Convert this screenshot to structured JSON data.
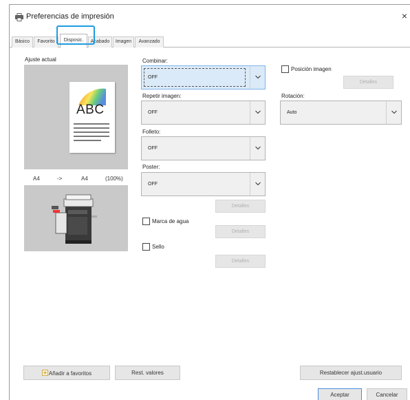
{
  "window": {
    "title": "Preferencias de impresión",
    "close_glyph": "×"
  },
  "tabs": [
    {
      "label": "Básico"
    },
    {
      "label": "Favorito"
    },
    {
      "label": "Disposic."
    },
    {
      "label": "Acabado"
    },
    {
      "label": "Imagen"
    },
    {
      "label": "Avanzado"
    }
  ],
  "active_tab": "Disposic.",
  "preview": {
    "label": "Ajuste actual",
    "paper_text": "ABC",
    "size_from": "A4",
    "arrow": "->",
    "size_to": "A4",
    "scale": "(100%)"
  },
  "combinar": {
    "label": "Combinar:",
    "value": "OFF"
  },
  "repetir": {
    "label": "Repetir imagen:",
    "value": "OFF"
  },
  "folleto": {
    "label": "Folleto:",
    "value": "OFF"
  },
  "poster": {
    "label": "Poster:",
    "value": "OFF",
    "details": "Detalles"
  },
  "marca_agua": {
    "label": "Marca de agua",
    "checked": false,
    "details": "Detalles"
  },
  "sello": {
    "label": "Sello",
    "checked": false,
    "details": "Detalles"
  },
  "posicion": {
    "label": "Posición imagen",
    "checked": false,
    "details": "Detalles"
  },
  "rotacion": {
    "label": "Rotación:",
    "value": "Auto"
  },
  "footer": {
    "add_fav": "Añadir a favoritos",
    "reset": "Rest. valores",
    "restore": "Restablecer ajust.usuario",
    "ok": "Aceptar",
    "cancel": "Cancelar"
  },
  "colors": {
    "highlight": "#1e9be0",
    "focus_fill": "#dbeaf8",
    "preview_bg": "#c9c9c9"
  },
  "icons": [
    "printer-icon",
    "close-icon",
    "chevron-down-icon",
    "favorite-add-icon"
  ]
}
